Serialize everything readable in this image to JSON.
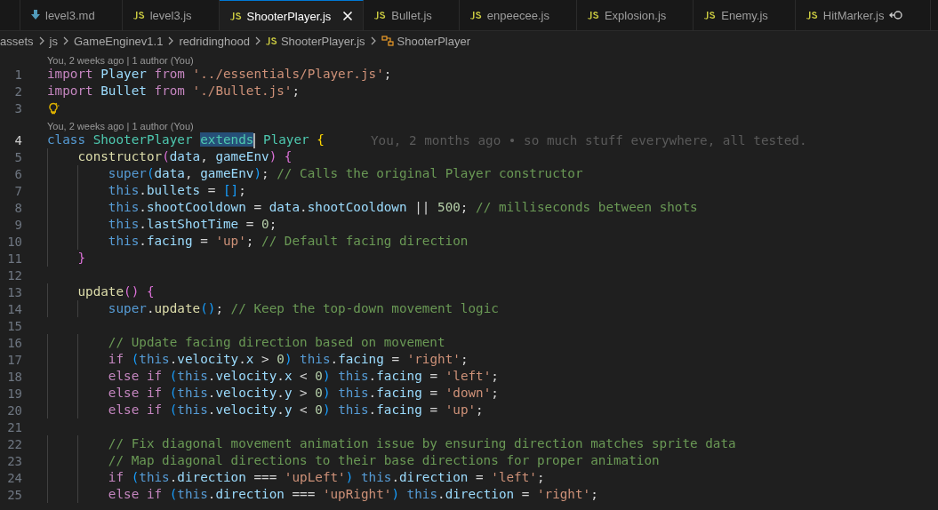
{
  "tabs": [
    {
      "kind": "markdown",
      "label": "level3.md",
      "selected": false
    },
    {
      "kind": "javascript",
      "label": "level3.js",
      "selected": false
    },
    {
      "kind": "javascript",
      "label": "ShooterPlayer.js",
      "selected": true
    },
    {
      "kind": "javascript",
      "label": "Bullet.js",
      "selected": false
    },
    {
      "kind": "javascript",
      "label": "enpeecee.js",
      "selected": false
    },
    {
      "kind": "javascript",
      "label": "Explosion.js",
      "selected": false
    },
    {
      "kind": "javascript",
      "label": "Enemy.js",
      "selected": false
    },
    {
      "kind": "javascript",
      "label": "HitMarker.js",
      "selected": false,
      "compare": true
    }
  ],
  "breadcrumb": [
    {
      "kind": "folder",
      "label": "assets"
    },
    {
      "kind": "folder",
      "label": "js"
    },
    {
      "kind": "folder",
      "label": "GameEnginev1.1"
    },
    {
      "kind": "folder",
      "label": "redridinghood"
    },
    {
      "kind": "file",
      "label": "ShooterPlayer.js"
    },
    {
      "kind": "symbol",
      "label": "ShooterPlayer"
    }
  ],
  "lines": [
    {
      "kind": "lens",
      "text": "You, 2 weeks ago | 1 author (You)"
    },
    {
      "kind": "code",
      "number": "1",
      "current": false,
      "tokens": [
        {
          "kind": "kw",
          "text": "import "
        },
        {
          "kind": "var",
          "text": "Player "
        },
        {
          "kind": "kw",
          "text": "from "
        },
        {
          "kind": "str",
          "text": "'../essentials/Player.js'"
        },
        {
          "kind": "p",
          "text": ";"
        }
      ]
    },
    {
      "kind": "code",
      "number": "2",
      "current": false,
      "tokens": [
        {
          "kind": "kw",
          "text": "import "
        },
        {
          "kind": "var",
          "text": "Bullet "
        },
        {
          "kind": "kw",
          "text": "from "
        },
        {
          "kind": "str",
          "text": "'./Bullet.js'"
        },
        {
          "kind": "p",
          "text": ";"
        }
      ]
    },
    {
      "kind": "code",
      "number": "3",
      "current": false,
      "lightbulb": true
    },
    {
      "kind": "lens",
      "text": "You, 2 weeks ago | 1 author (You)"
    },
    {
      "kind": "code",
      "number": "4",
      "current": true,
      "tokens": [
        {
          "kind": "kw2",
          "text": "class "
        },
        {
          "kind": "cls",
          "text": "ShooterPlayer "
        },
        {
          "kind": "sel",
          "text": "extends"
        },
        {
          "kind": "cls",
          "text": " Player "
        },
        {
          "kind": "b1",
          "text": "{"
        }
      ],
      "blame": "You, 2 months ago • so much stuff everywhere, all tested."
    },
    {
      "kind": "code",
      "number": "5",
      "current": false,
      "tokens": [
        {
          "kind": "fn",
          "text": "    constructor"
        },
        {
          "kind": "b2",
          "text": "("
        },
        {
          "kind": "var",
          "text": "data"
        },
        {
          "kind": "p",
          "text": ", "
        },
        {
          "kind": "var",
          "text": "gameEnv"
        },
        {
          "kind": "b2",
          "text": ")"
        },
        {
          "kind": "b2",
          "text": " {"
        }
      ]
    },
    {
      "kind": "code",
      "number": "6",
      "current": false,
      "tokens": [
        {
          "kind": "kw2",
          "text": "        super"
        },
        {
          "kind": "b3",
          "text": "("
        },
        {
          "kind": "var",
          "text": "data"
        },
        {
          "kind": "p",
          "text": ", "
        },
        {
          "kind": "var",
          "text": "gameEnv"
        },
        {
          "kind": "b3",
          "text": ")"
        },
        {
          "kind": "p",
          "text": ";"
        },
        {
          "kind": "cmt",
          "text": " // Calls the original Player constructor"
        }
      ]
    },
    {
      "kind": "code",
      "number": "7",
      "current": false,
      "tokens": [
        {
          "kind": "kw2",
          "text": "        this"
        },
        {
          "kind": "p",
          "text": "."
        },
        {
          "kind": "var",
          "text": "bullets"
        },
        {
          "kind": "p",
          "text": " = "
        },
        {
          "kind": "b3",
          "text": "[]"
        },
        {
          "kind": "p",
          "text": ";"
        }
      ]
    },
    {
      "kind": "code",
      "number": "8",
      "current": false,
      "tokens": [
        {
          "kind": "kw2",
          "text": "        this"
        },
        {
          "kind": "p",
          "text": "."
        },
        {
          "kind": "var",
          "text": "shootCooldown"
        },
        {
          "kind": "p",
          "text": " = "
        },
        {
          "kind": "var",
          "text": "data"
        },
        {
          "kind": "p",
          "text": "."
        },
        {
          "kind": "var",
          "text": "shootCooldown"
        },
        {
          "kind": "p",
          "text": " || "
        },
        {
          "kind": "num",
          "text": "500"
        },
        {
          "kind": "p",
          "text": ";"
        },
        {
          "kind": "cmt",
          "text": " // milliseconds between shots"
        }
      ]
    },
    {
      "kind": "code",
      "number": "9",
      "current": false,
      "tokens": [
        {
          "kind": "kw2",
          "text": "        this"
        },
        {
          "kind": "p",
          "text": "."
        },
        {
          "kind": "var",
          "text": "lastShotTime"
        },
        {
          "kind": "p",
          "text": " = "
        },
        {
          "kind": "num",
          "text": "0"
        },
        {
          "kind": "p",
          "text": ";"
        }
      ]
    },
    {
      "kind": "code",
      "number": "10",
      "current": false,
      "tokens": [
        {
          "kind": "kw2",
          "text": "        this"
        },
        {
          "kind": "p",
          "text": "."
        },
        {
          "kind": "var",
          "text": "facing"
        },
        {
          "kind": "p",
          "text": " = "
        },
        {
          "kind": "str",
          "text": "'up'"
        },
        {
          "kind": "p",
          "text": ";"
        },
        {
          "kind": "cmt",
          "text": " // Default facing direction"
        }
      ]
    },
    {
      "kind": "code",
      "number": "11",
      "current": false,
      "tokens": [
        {
          "kind": "b2",
          "text": "    }"
        }
      ]
    },
    {
      "kind": "code",
      "number": "12",
      "current": false
    },
    {
      "kind": "code",
      "number": "13",
      "current": false,
      "tokens": [
        {
          "kind": "fn",
          "text": "    update"
        },
        {
          "kind": "b2",
          "text": "()"
        },
        {
          "kind": "b2",
          "text": " {"
        }
      ]
    },
    {
      "kind": "code",
      "number": "14",
      "current": false,
      "tokens": [
        {
          "kind": "kw2",
          "text": "        super"
        },
        {
          "kind": "p",
          "text": "."
        },
        {
          "kind": "fn",
          "text": "update"
        },
        {
          "kind": "b3",
          "text": "()"
        },
        {
          "kind": "p",
          "text": ";"
        },
        {
          "kind": "cmt",
          "text": " // Keep the top-down movement logic"
        }
      ]
    },
    {
      "kind": "code",
      "number": "15",
      "current": false
    },
    {
      "kind": "code",
      "number": "16",
      "current": false,
      "tokens": [
        {
          "kind": "cmt",
          "text": "        // Update facing direction based on movement"
        }
      ]
    },
    {
      "kind": "code",
      "number": "17",
      "current": false,
      "tokens": [
        {
          "kind": "kw",
          "text": "        if "
        },
        {
          "kind": "b3",
          "text": "("
        },
        {
          "kind": "kw2",
          "text": "this"
        },
        {
          "kind": "p",
          "text": "."
        },
        {
          "kind": "var",
          "text": "velocity"
        },
        {
          "kind": "p",
          "text": "."
        },
        {
          "kind": "var",
          "text": "x"
        },
        {
          "kind": "p",
          "text": " > "
        },
        {
          "kind": "num",
          "text": "0"
        },
        {
          "kind": "b3",
          "text": ")"
        },
        {
          "kind": "kw2",
          "text": " this"
        },
        {
          "kind": "p",
          "text": "."
        },
        {
          "kind": "var",
          "text": "facing"
        },
        {
          "kind": "p",
          "text": " = "
        },
        {
          "kind": "str",
          "text": "'right'"
        },
        {
          "kind": "p",
          "text": ";"
        }
      ]
    },
    {
      "kind": "code",
      "number": "18",
      "current": false,
      "tokens": [
        {
          "kind": "kw",
          "text": "        else if "
        },
        {
          "kind": "b3",
          "text": "("
        },
        {
          "kind": "kw2",
          "text": "this"
        },
        {
          "kind": "p",
          "text": "."
        },
        {
          "kind": "var",
          "text": "velocity"
        },
        {
          "kind": "p",
          "text": "."
        },
        {
          "kind": "var",
          "text": "x"
        },
        {
          "kind": "p",
          "text": " < "
        },
        {
          "kind": "num",
          "text": "0"
        },
        {
          "kind": "b3",
          "text": ")"
        },
        {
          "kind": "kw2",
          "text": " this"
        },
        {
          "kind": "p",
          "text": "."
        },
        {
          "kind": "var",
          "text": "facing"
        },
        {
          "kind": "p",
          "text": " = "
        },
        {
          "kind": "str",
          "text": "'left'"
        },
        {
          "kind": "p",
          "text": ";"
        }
      ]
    },
    {
      "kind": "code",
      "number": "19",
      "current": false,
      "tokens": [
        {
          "kind": "kw",
          "text": "        else if "
        },
        {
          "kind": "b3",
          "text": "("
        },
        {
          "kind": "kw2",
          "text": "this"
        },
        {
          "kind": "p",
          "text": "."
        },
        {
          "kind": "var",
          "text": "velocity"
        },
        {
          "kind": "p",
          "text": "."
        },
        {
          "kind": "var",
          "text": "y"
        },
        {
          "kind": "p",
          "text": " > "
        },
        {
          "kind": "num",
          "text": "0"
        },
        {
          "kind": "b3",
          "text": ")"
        },
        {
          "kind": "kw2",
          "text": " this"
        },
        {
          "kind": "p",
          "text": "."
        },
        {
          "kind": "var",
          "text": "facing"
        },
        {
          "kind": "p",
          "text": " = "
        },
        {
          "kind": "str",
          "text": "'down'"
        },
        {
          "kind": "p",
          "text": ";"
        }
      ]
    },
    {
      "kind": "code",
      "number": "20",
      "current": false,
      "tokens": [
        {
          "kind": "kw",
          "text": "        else if "
        },
        {
          "kind": "b3",
          "text": "("
        },
        {
          "kind": "kw2",
          "text": "this"
        },
        {
          "kind": "p",
          "text": "."
        },
        {
          "kind": "var",
          "text": "velocity"
        },
        {
          "kind": "p",
          "text": "."
        },
        {
          "kind": "var",
          "text": "y"
        },
        {
          "kind": "p",
          "text": " < "
        },
        {
          "kind": "num",
          "text": "0"
        },
        {
          "kind": "b3",
          "text": ")"
        },
        {
          "kind": "kw2",
          "text": " this"
        },
        {
          "kind": "p",
          "text": "."
        },
        {
          "kind": "var",
          "text": "facing"
        },
        {
          "kind": "p",
          "text": " = "
        },
        {
          "kind": "str",
          "text": "'up'"
        },
        {
          "kind": "p",
          "text": ";"
        }
      ]
    },
    {
      "kind": "code",
      "number": "21",
      "current": false
    },
    {
      "kind": "code",
      "number": "22",
      "current": false,
      "tokens": [
        {
          "kind": "cmt",
          "text": "        // Fix diagonal movement animation issue by ensuring direction matches sprite data"
        }
      ]
    },
    {
      "kind": "code",
      "number": "23",
      "current": false,
      "tokens": [
        {
          "kind": "cmt",
          "text": "        // Map diagonal directions to their base directions for proper animation"
        }
      ]
    },
    {
      "kind": "code",
      "number": "24",
      "current": false,
      "tokens": [
        {
          "kind": "kw",
          "text": "        if "
        },
        {
          "kind": "b3",
          "text": "("
        },
        {
          "kind": "kw2",
          "text": "this"
        },
        {
          "kind": "p",
          "text": "."
        },
        {
          "kind": "var",
          "text": "direction"
        },
        {
          "kind": "p",
          "text": " === "
        },
        {
          "kind": "str",
          "text": "'upLeft'"
        },
        {
          "kind": "b3",
          "text": ")"
        },
        {
          "kind": "kw2",
          "text": " this"
        },
        {
          "kind": "p",
          "text": "."
        },
        {
          "kind": "var",
          "text": "direction"
        },
        {
          "kind": "p",
          "text": " = "
        },
        {
          "kind": "str",
          "text": "'left'"
        },
        {
          "kind": "p",
          "text": ";"
        }
      ]
    },
    {
      "kind": "code",
      "number": "25",
      "current": false,
      "tokens": [
        {
          "kind": "kw",
          "text": "        else if "
        },
        {
          "kind": "b3",
          "text": "("
        },
        {
          "kind": "kw2",
          "text": "this"
        },
        {
          "kind": "p",
          "text": "."
        },
        {
          "kind": "var",
          "text": "direction"
        },
        {
          "kind": "p",
          "text": " === "
        },
        {
          "kind": "str",
          "text": "'upRight'"
        },
        {
          "kind": "b3",
          "text": ")"
        },
        {
          "kind": "kw2",
          "text": " this"
        },
        {
          "kind": "p",
          "text": "."
        },
        {
          "kind": "var",
          "text": "direction"
        },
        {
          "kind": "p",
          "text": " = "
        },
        {
          "kind": "str",
          "text": "'right'"
        },
        {
          "kind": "p",
          "text": ";"
        }
      ]
    }
  ]
}
